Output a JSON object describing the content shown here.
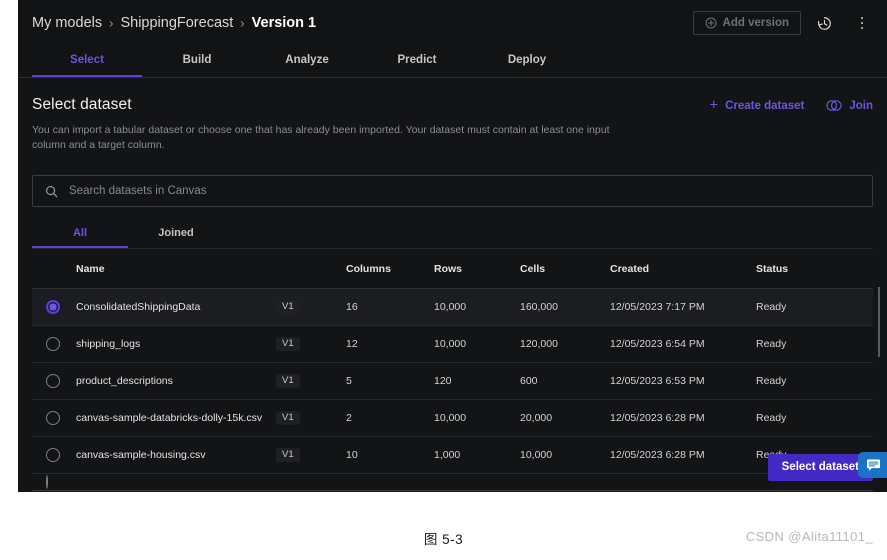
{
  "window": {
    "breadcrumb": {
      "items": [
        {
          "label": "My models",
          "current": false
        },
        {
          "label": "ShippingForecast",
          "current": false
        },
        {
          "label": "Version 1",
          "current": true
        }
      ],
      "separator": "›"
    },
    "top_actions": {
      "add_version_label": "Add version",
      "add_version_icon": "plus-circle-icon",
      "history_icon": "history-clock-icon",
      "more_icon": "kebab-menu-icon"
    },
    "tabs": [
      {
        "label": "Select",
        "active": true
      },
      {
        "label": "Build",
        "active": false
      },
      {
        "label": "Analyze",
        "active": false
      },
      {
        "label": "Predict",
        "active": false
      },
      {
        "label": "Deploy",
        "active": false
      }
    ]
  },
  "panel": {
    "title": "Select dataset",
    "description": "You can import a tabular dataset or choose one that has already been imported. Your dataset must contain at least one input column and a target column.",
    "actions": [
      {
        "label": "Create dataset",
        "icon": "plus-icon"
      },
      {
        "label": "Join",
        "icon": "join-venn-icon"
      }
    ],
    "search": {
      "placeholder": "Search datasets in Canvas",
      "value": "",
      "icon": "search-icon"
    },
    "subtabs": [
      {
        "label": "All",
        "active": true
      },
      {
        "label": "Joined",
        "active": false
      }
    ],
    "footer": {
      "select_dataset_label": "Select dataset"
    }
  },
  "table": {
    "columns": [
      "Name",
      "",
      "Columns",
      "Rows",
      "Cells",
      "Created",
      "Status"
    ],
    "rows": [
      {
        "name": "ConsolidatedShippingData",
        "version": "V1",
        "columns": "16",
        "rows": "10,000",
        "cells": "160,000",
        "created": "12/05/2023 7:17 PM",
        "status": "Ready",
        "selected": true
      },
      {
        "name": "shipping_logs",
        "version": "V1",
        "columns": "12",
        "rows": "10,000",
        "cells": "120,000",
        "created": "12/05/2023 6:54 PM",
        "status": "Ready",
        "selected": false
      },
      {
        "name": "product_descriptions",
        "version": "V1",
        "columns": "5",
        "rows": "120",
        "cells": "600",
        "created": "12/05/2023 6:53 PM",
        "status": "Ready",
        "selected": false
      },
      {
        "name": "canvas-sample-databricks-dolly-15k.csv",
        "version": "V1",
        "columns": "2",
        "rows": "10,000",
        "cells": "20,000",
        "created": "12/05/2023 6:28 PM",
        "status": "Ready",
        "selected": false
      },
      {
        "name": "canvas-sample-housing.csv",
        "version": "V1",
        "columns": "10",
        "rows": "1,000",
        "cells": "10,000",
        "created": "12/05/2023 6:28 PM",
        "status": "Ready",
        "selected": false
      }
    ]
  },
  "chat_launcher": {
    "icon": "chat-bubble-icon"
  },
  "figure": {
    "caption": "图 5-3",
    "watermark": "CSDN @Alita11101_"
  },
  "colors": {
    "accent_purple": "#5d3fe8",
    "accent_purple_text": "#6a55e0",
    "primary_button": "#4429c4",
    "chat_blue": "#1a73c4",
    "window_bg": "#0f1011",
    "panel_bg": "#131415"
  }
}
